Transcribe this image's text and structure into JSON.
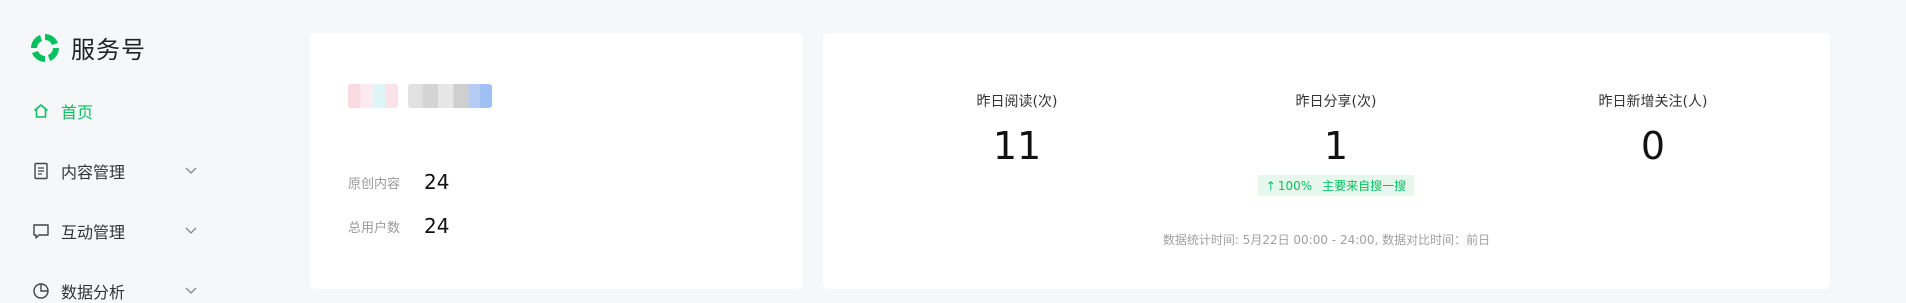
{
  "brand": {
    "title": "服务号",
    "logo_icon": "wechat-service-logo",
    "accent": "#07c160"
  },
  "sidebar": {
    "items": [
      {
        "label": "首页",
        "icon": "home-icon",
        "active": true
      },
      {
        "label": "内容管理",
        "icon": "document-icon",
        "expandable": true
      },
      {
        "label": "互动管理",
        "icon": "chat-icon",
        "expandable": true
      },
      {
        "label": "数据分析",
        "icon": "pie-chart-icon",
        "expandable": true
      }
    ]
  },
  "account_card": {
    "stats": [
      {
        "label": "原创内容",
        "value": "24"
      },
      {
        "label": "总用户数",
        "value": "24"
      }
    ]
  },
  "metrics_card": {
    "metrics": [
      {
        "label": "昨日阅读(次)",
        "value": "11"
      },
      {
        "label": "昨日分享(次)",
        "value": "1",
        "badge": {
          "change": "100%",
          "source": "主要来自搜一搜"
        }
      },
      {
        "label": "昨日新增关注(人)",
        "value": "0"
      }
    ],
    "footnote": "数据统计时间: 5月22日 00:00 - 24:00, 数据对比时间：前日"
  }
}
